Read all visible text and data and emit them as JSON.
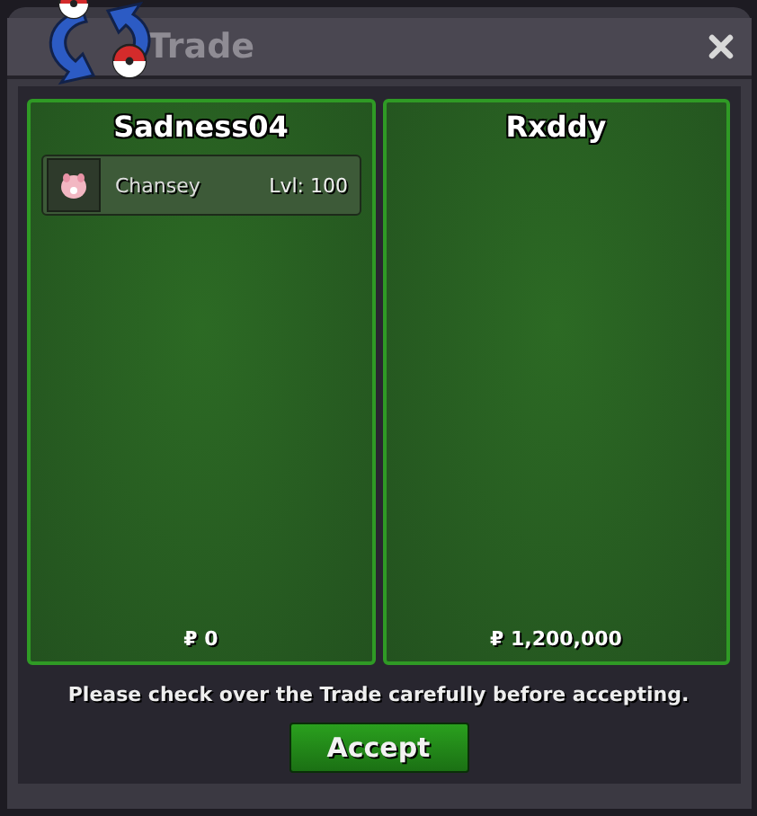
{
  "window": {
    "title": "Trade"
  },
  "panels": [
    {
      "player": "Sadness04",
      "items": [
        {
          "name": "Chansey",
          "level": "Lvl: 100"
        }
      ],
      "money": "₽ 0"
    },
    {
      "player": "Rxddy",
      "money": "₽ 1,200,000"
    }
  ],
  "notice": "Please check over the Trade carefully before accepting.",
  "accept_button": "Accept"
}
